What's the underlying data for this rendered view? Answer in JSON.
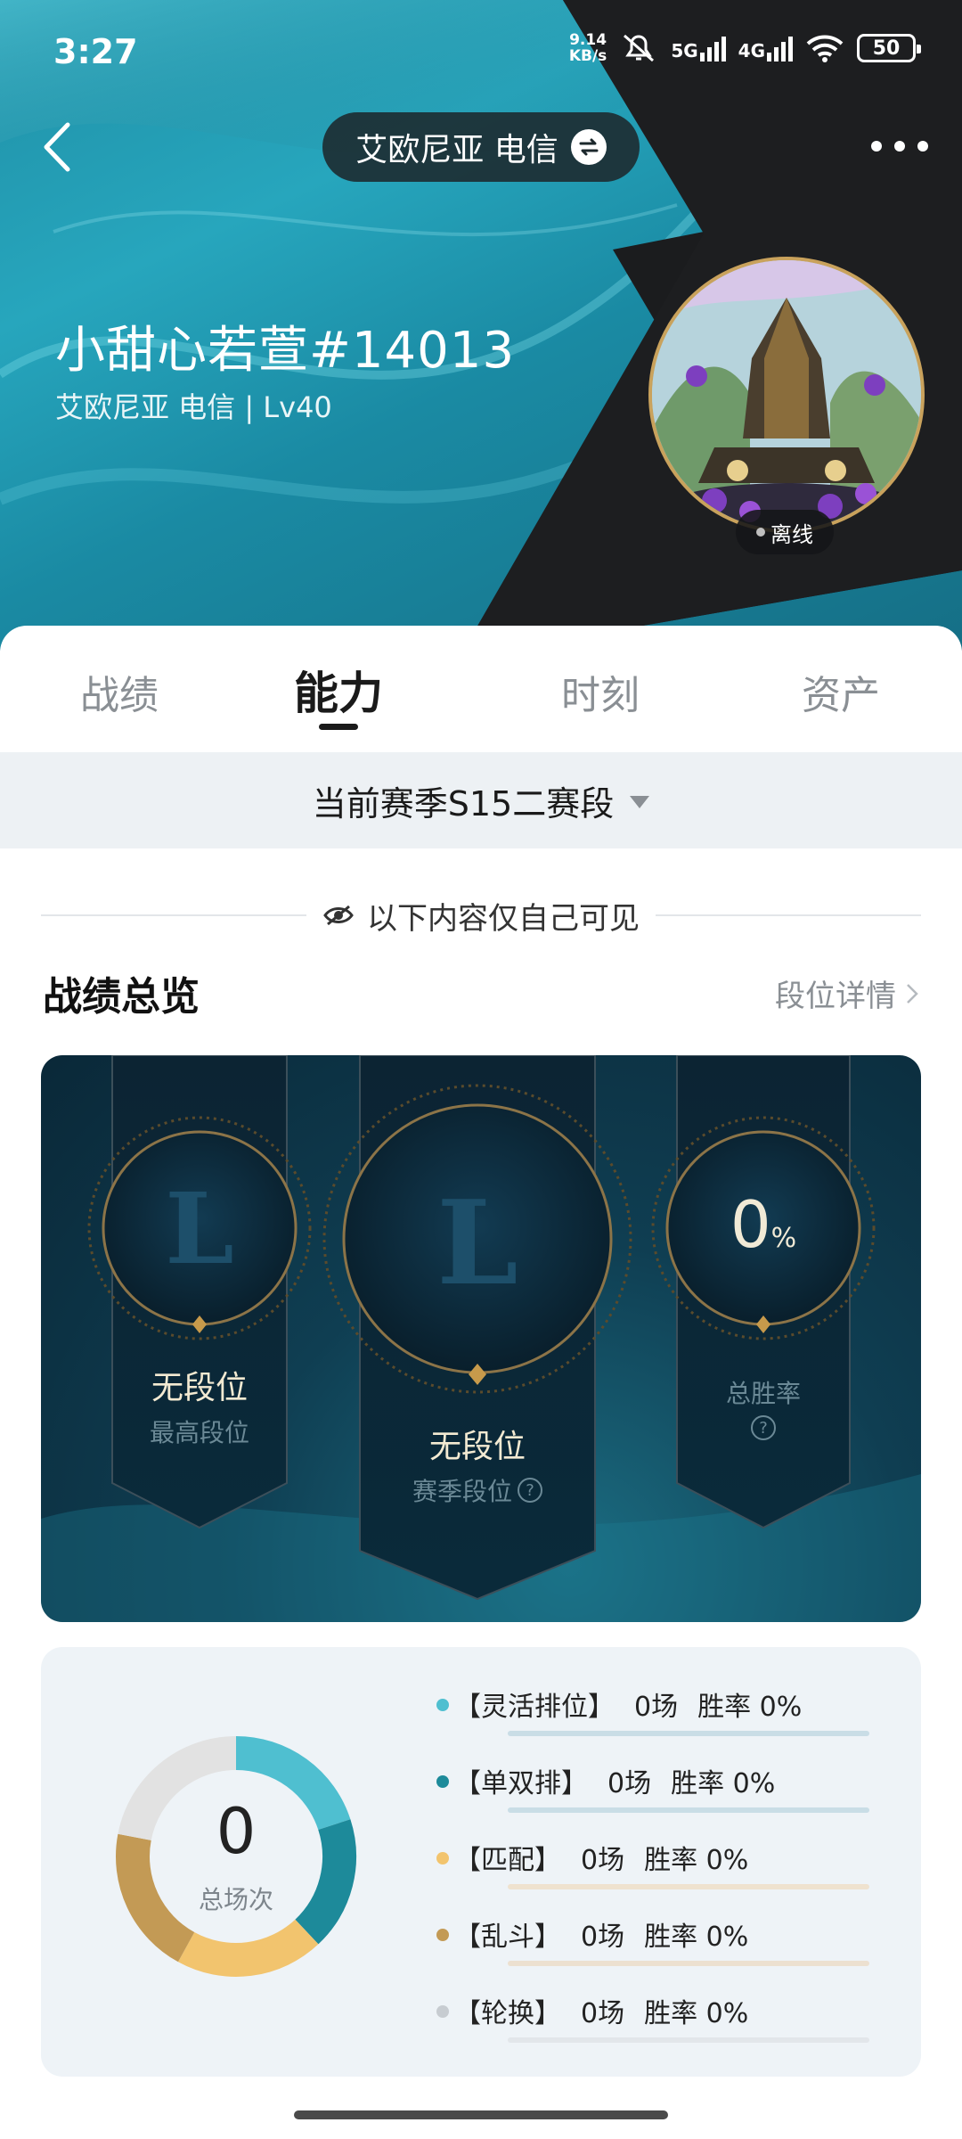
{
  "status_bar": {
    "time": "3:27",
    "speed_value": "9.14",
    "speed_unit": "KB/s",
    "net1": "5G",
    "net2": "4G",
    "battery": "50"
  },
  "header": {
    "server_label": "艾欧尼亚 电信",
    "username": "小甜心若萱#14013",
    "userinfo": "艾欧尼亚 电信 | Lv40",
    "status": "离线"
  },
  "tabs": [
    {
      "label": "战绩"
    },
    {
      "label": "能力"
    },
    {
      "label": "时刻"
    },
    {
      "label": "资产"
    }
  ],
  "active_tab": "能力",
  "season_selector": "当前赛季S15二赛段",
  "privacy_note": "以下内容仅自己可见",
  "overview": {
    "title": "战绩总览",
    "detail_link": "段位详情",
    "highest": {
      "rank": "无段位",
      "label": "最高段位"
    },
    "season": {
      "rank": "无段位",
      "label": "赛季段位"
    },
    "winrate": {
      "value": "0",
      "unit": "%",
      "label": "总胜率"
    },
    "emblem_letter": "L"
  },
  "stats": {
    "total_games": "0",
    "total_label": "总场次",
    "modes": [
      {
        "name": "【灵活排位】",
        "games": "0场",
        "winrate": "胜率 0%",
        "color": "#4fbfd0",
        "bar": "#c9dde6"
      },
      {
        "name": "【单双排】",
        "games": "0场",
        "winrate": "胜率 0%",
        "color": "#1d8a9a",
        "bar": "#c9dde6"
      },
      {
        "name": "【匹配】",
        "games": "0场",
        "winrate": "胜率 0%",
        "color": "#f2c46e",
        "bar": "#efe2cf"
      },
      {
        "name": "【乱斗】",
        "games": "0场",
        "winrate": "胜率 0%",
        "color": "#c39a55",
        "bar": "#ece0d0"
      },
      {
        "name": "【轮换】",
        "games": "0场",
        "winrate": "胜率 0%",
        "color": "#c7ccd1",
        "bar": "#e2e6ea"
      }
    ],
    "donut_segments": [
      {
        "color": "#4fbfd0",
        "share": 0.2
      },
      {
        "color": "#1d8a9a",
        "share": 0.18
      },
      {
        "color": "#f2c46e",
        "share": 0.2
      },
      {
        "color": "#c39a55",
        "share": 0.2
      },
      {
        "color": "#e2e2e2",
        "share": 0.22
      }
    ]
  }
}
